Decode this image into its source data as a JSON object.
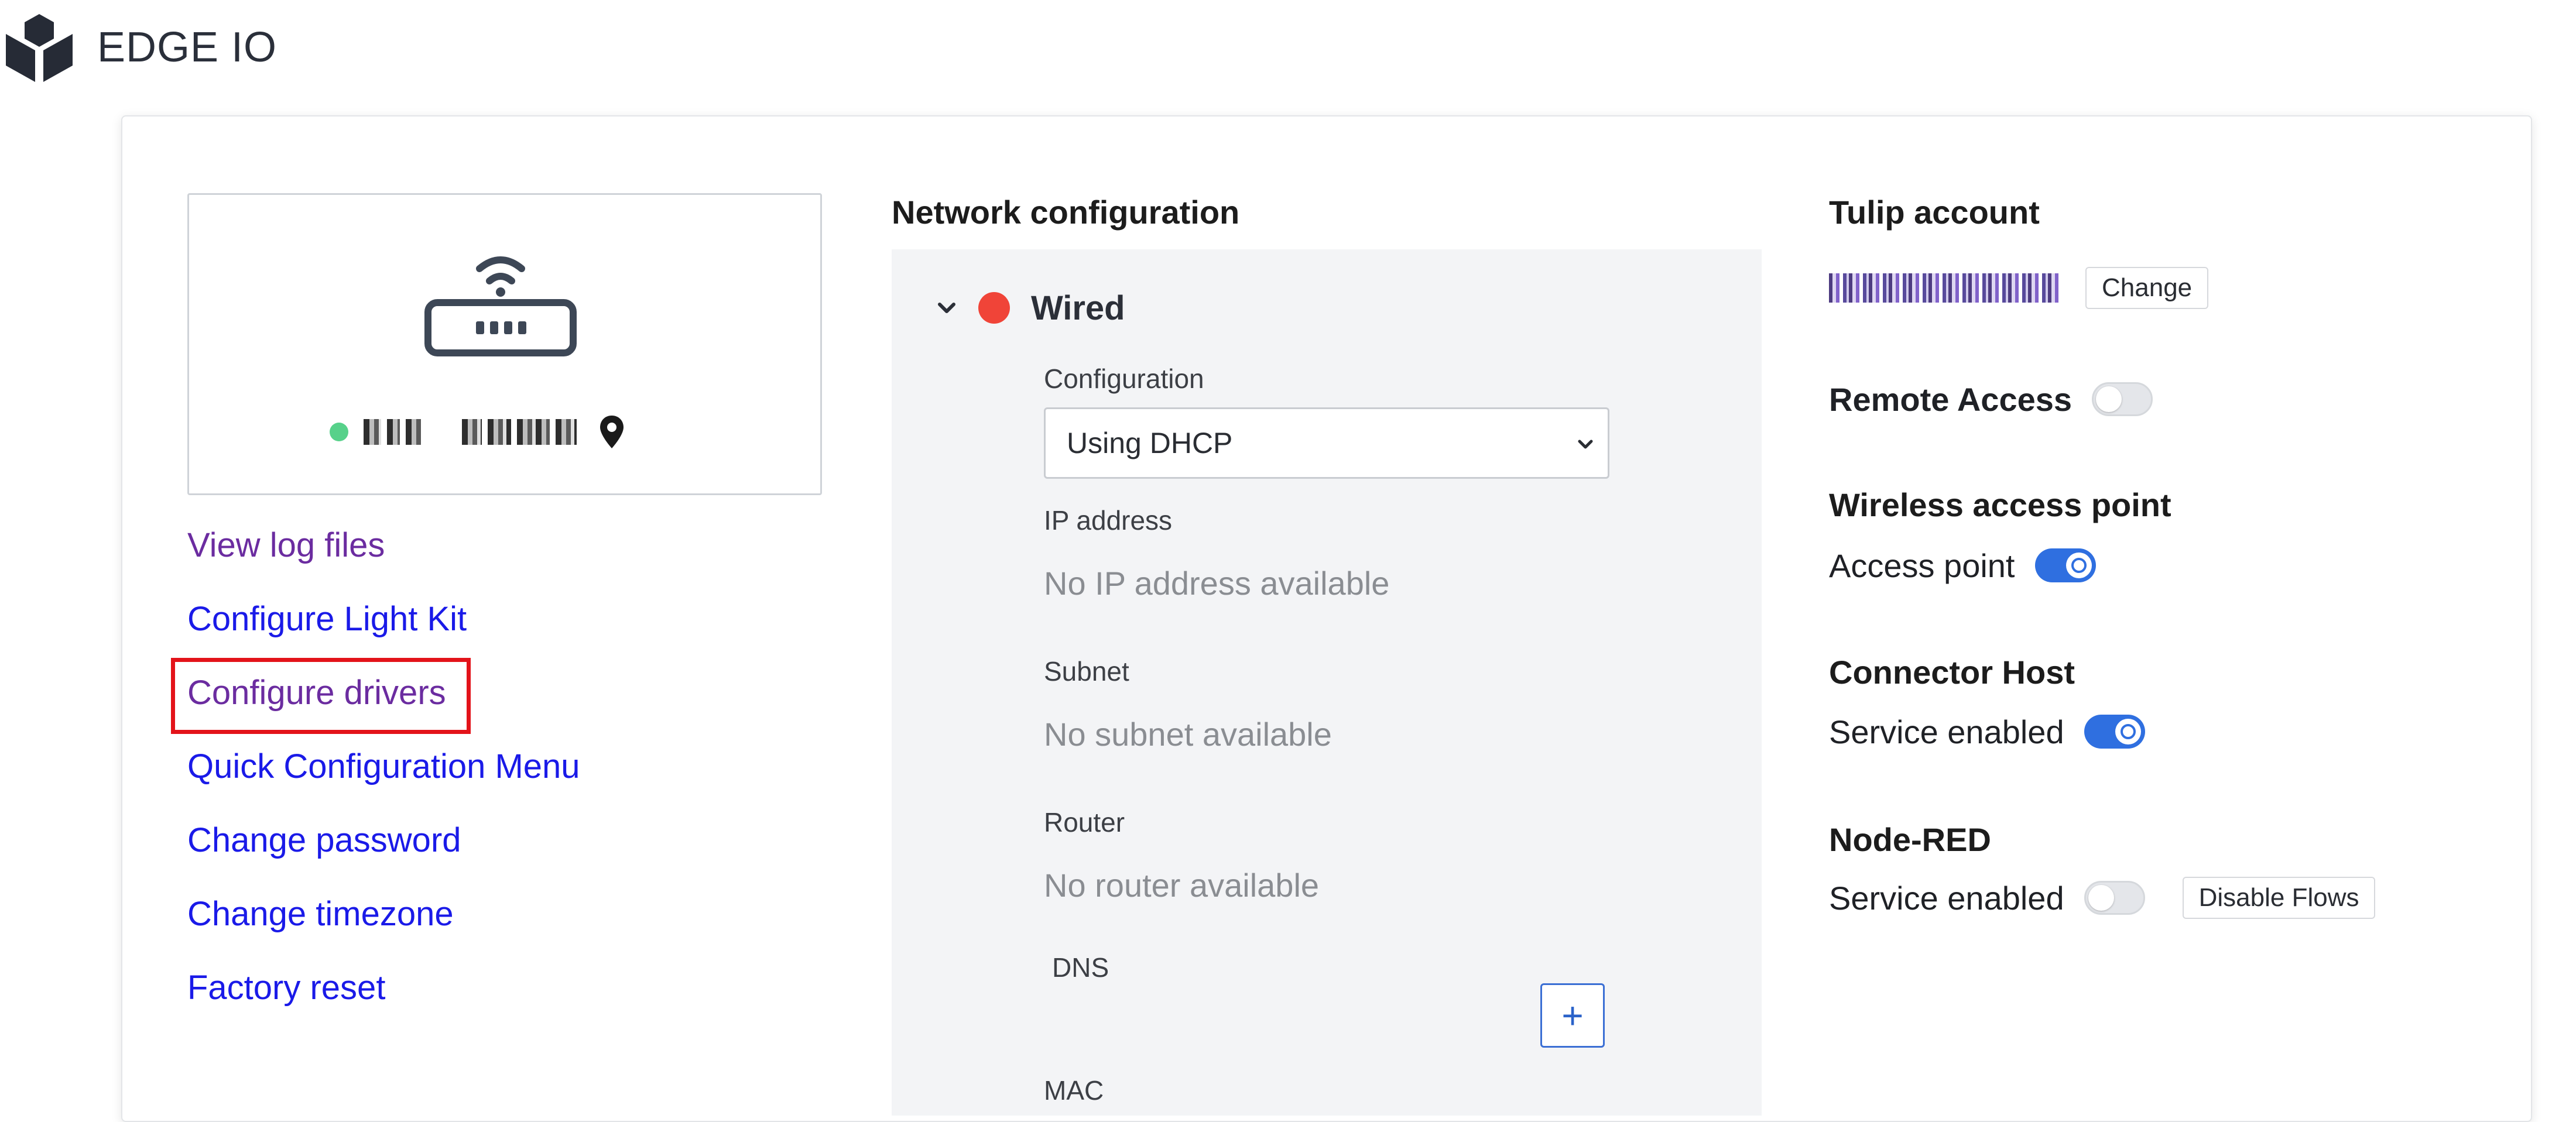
{
  "header": {
    "app_title": "EDGE IO",
    "logo_icon": "tulip-logo-icon"
  },
  "device": {
    "icon": "router-wifi-icon",
    "status_color": "#57d18a",
    "location_icon": "location-pin-icon"
  },
  "left_links": [
    {
      "label": "View log files",
      "visited": true
    },
    {
      "label": "Configure Light Kit",
      "visited": false
    },
    {
      "label": "Configure drivers",
      "visited": true,
      "highlighted": true
    },
    {
      "label": "Quick Configuration Menu",
      "visited": false
    },
    {
      "label": "Change password",
      "visited": false
    },
    {
      "label": "Change timezone",
      "visited": false
    },
    {
      "label": "Factory reset",
      "visited": false
    }
  ],
  "network": {
    "title": "Network configuration",
    "interface_label": "Wired",
    "interface_status_color": "#f04438",
    "configuration_label": "Configuration",
    "configuration_value": "Using DHCP",
    "ip_label": "IP address",
    "ip_value": "No IP address available",
    "subnet_label": "Subnet",
    "subnet_value": "No subnet available",
    "router_label": "Router",
    "router_value": "No router available",
    "dns_label": "DNS",
    "dns_add_label": "+",
    "mac_label": "MAC"
  },
  "account": {
    "title": "Tulip account",
    "change_label": "Change"
  },
  "remote_access": {
    "title": "Remote Access",
    "enabled": false
  },
  "wireless": {
    "title": "Wireless access point",
    "row_label": "Access point",
    "enabled": true
  },
  "connector_host": {
    "title": "Connector Host",
    "row_label": "Service enabled",
    "enabled": true
  },
  "node_red": {
    "title": "Node-RED",
    "row_label": "Service enabled",
    "enabled": false,
    "disable_flows_label": "Disable Flows"
  },
  "colors": {
    "link_blue": "#1a1ae8",
    "link_visited": "#6b2ca0",
    "toggle_on": "#2f6fe0",
    "highlight_red": "#e3131a"
  }
}
